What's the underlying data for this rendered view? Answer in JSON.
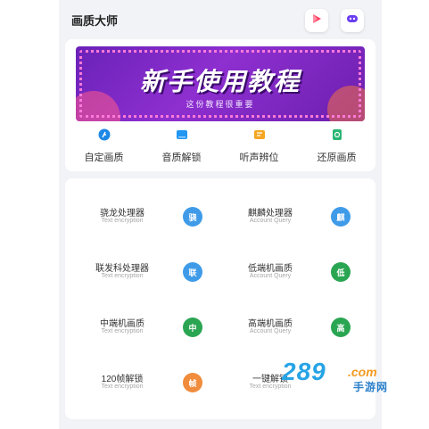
{
  "header": {
    "title": "画质大师",
    "icons": [
      "play-icon",
      "discord-icon"
    ]
  },
  "banner": {
    "title": "新手使用教程",
    "subtitle": "这份教程很重要"
  },
  "quick_actions": [
    {
      "label": "自定画质",
      "icon": "custom-quality-icon",
      "color": "#1e88e5"
    },
    {
      "label": "音质解锁",
      "icon": "audio-unlock-icon",
      "color": "#2196f3"
    },
    {
      "label": "听声辨位",
      "icon": "sound-locate-icon",
      "color": "#f5a623"
    },
    {
      "label": "还原画质",
      "icon": "restore-quality-icon",
      "color": "#2bb673"
    }
  ],
  "features": [
    {
      "name": "骁龙处理器",
      "sub": "Text encryption",
      "badge": "骁",
      "color": "#3f9be8"
    },
    {
      "name": "麒麟处理器",
      "sub": "Account Query",
      "badge": "麒",
      "color": "#3f9be8"
    },
    {
      "name": "联发科处理器",
      "sub": "Text encryption",
      "badge": "联",
      "color": "#3f9be8"
    },
    {
      "name": "低端机画质",
      "sub": "Account Query",
      "badge": "低",
      "color": "#2aa552"
    },
    {
      "name": "中端机画质",
      "sub": "Text encryption",
      "badge": "中",
      "color": "#2aa552"
    },
    {
      "name": "高端机画质",
      "sub": "Account Query",
      "badge": "高",
      "color": "#2aa552"
    },
    {
      "name": "120帧解锁",
      "sub": "Text encryption",
      "badge": "帧",
      "color": "#f08c3c"
    },
    {
      "name": "一键解锁",
      "sub": "Text encryption",
      "badge": "",
      "color": "#f08c3c"
    }
  ],
  "watermark": {
    "number": "289",
    "domain": ".com",
    "text": "手游网"
  }
}
